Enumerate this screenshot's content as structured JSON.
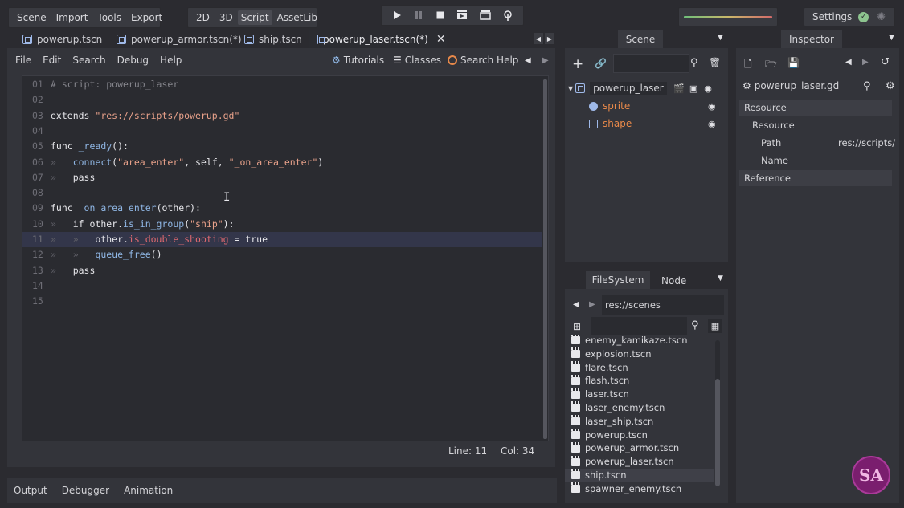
{
  "menus": {
    "scene": "Scene",
    "import": "Import",
    "tools": "Tools",
    "export": "Export"
  },
  "workspace": {
    "w2d": "2D",
    "w3d": "3D",
    "script": "Script",
    "assetlib": "AssetLib"
  },
  "settings_label": "Settings",
  "tabs": [
    {
      "label": "powerup.tscn"
    },
    {
      "label": "powerup_armor.tscn(*)"
    },
    {
      "label": "ship.tscn"
    },
    {
      "label": "powerup_laser.tscn(*)"
    }
  ],
  "script_menu": {
    "file": "File",
    "edit": "Edit",
    "search": "Search",
    "debug": "Debug",
    "help": "Help",
    "tutorials": "Tutorials",
    "classes": "Classes",
    "search_help": "Search Help"
  },
  "code": [
    {
      "n": "01",
      "seg": [
        {
          "c": "cmt",
          "t": "# script: powerup_laser"
        }
      ]
    },
    {
      "n": "02",
      "seg": []
    },
    {
      "n": "03",
      "seg": [
        {
          "c": "kw",
          "t": "extends "
        },
        {
          "c": "str",
          "t": "\"res://scripts/powerup.gd\""
        }
      ]
    },
    {
      "n": "04",
      "seg": []
    },
    {
      "n": "05",
      "seg": [
        {
          "c": "kw",
          "t": "func "
        },
        {
          "c": "fn",
          "t": "_ready"
        },
        {
          "c": "kw",
          "t": "():"
        }
      ]
    },
    {
      "n": "06",
      "seg": [
        {
          "c": "tab-mark",
          "t": "»   "
        },
        {
          "c": "fn",
          "t": "connect"
        },
        {
          "c": "kw",
          "t": "("
        },
        {
          "c": "str",
          "t": "\"area_enter\""
        },
        {
          "c": "kw",
          "t": ", self, "
        },
        {
          "c": "str",
          "t": "\"_on_area_enter\""
        },
        {
          "c": "kw",
          "t": ")"
        }
      ]
    },
    {
      "n": "07",
      "seg": [
        {
          "c": "tab-mark",
          "t": "»   "
        },
        {
          "c": "kw",
          "t": "pass"
        }
      ]
    },
    {
      "n": "08",
      "seg": []
    },
    {
      "n": "09",
      "seg": [
        {
          "c": "kw",
          "t": "func "
        },
        {
          "c": "fn",
          "t": "_on_area_enter"
        },
        {
          "c": "kw",
          "t": "(other):"
        }
      ]
    },
    {
      "n": "10",
      "seg": [
        {
          "c": "tab-mark",
          "t": "»   "
        },
        {
          "c": "kw",
          "t": "if other."
        },
        {
          "c": "fn",
          "t": "is_in_group"
        },
        {
          "c": "kw",
          "t": "("
        },
        {
          "c": "str",
          "t": "\"ship\""
        },
        {
          "c": "kw",
          "t": "):"
        }
      ]
    },
    {
      "n": "11",
      "seg": [
        {
          "c": "tab-mark",
          "t": "»   »   "
        },
        {
          "c": "kw",
          "t": "other."
        },
        {
          "c": "prop",
          "t": "is_double_shooting"
        },
        {
          "c": "kw",
          "t": " = true"
        }
      ]
    },
    {
      "n": "12",
      "seg": [
        {
          "c": "tab-mark",
          "t": "»   »   "
        },
        {
          "c": "fn",
          "t": "queue_free"
        },
        {
          "c": "kw",
          "t": "()"
        }
      ]
    },
    {
      "n": "13",
      "seg": [
        {
          "c": "tab-mark",
          "t": "»   "
        },
        {
          "c": "kw",
          "t": "pass"
        }
      ]
    },
    {
      "n": "14",
      "seg": []
    },
    {
      "n": "15",
      "seg": []
    }
  ],
  "status": {
    "line": "Line: 11",
    "col": "Col: 34"
  },
  "bottom_tabs": {
    "output": "Output",
    "debugger": "Debugger",
    "animation": "Animation"
  },
  "scene_dock": {
    "title": "Scene",
    "root": "powerup_laser",
    "children": [
      {
        "label": "sprite"
      },
      {
        "label": "shape"
      }
    ]
  },
  "filesystem": {
    "tab": "FileSystem",
    "node_tab": "Node",
    "path": "res://scenes",
    "files": [
      "enemy_kamikaze.tscn",
      "explosion.tscn",
      "flare.tscn",
      "flash.tscn",
      "laser.tscn",
      "laser_enemy.tscn",
      "laser_ship.tscn",
      "powerup.tscn",
      "powerup_armor.tscn",
      "powerup_laser.tscn",
      "ship.tscn",
      "spawner_enemy.tscn"
    ],
    "selected": "ship.tscn"
  },
  "inspector": {
    "title": "Inspector",
    "resource_name": "powerup_laser.gd",
    "section_resource": "Resource",
    "sub_resource": "Resource",
    "path_label": "Path",
    "path_value": "res://scripts/",
    "name_label": "Name",
    "section_reference": "Reference"
  },
  "colors": {
    "accent": "#8fb6e4",
    "node_orange": "#e8894a",
    "string": "#e8a18a"
  }
}
